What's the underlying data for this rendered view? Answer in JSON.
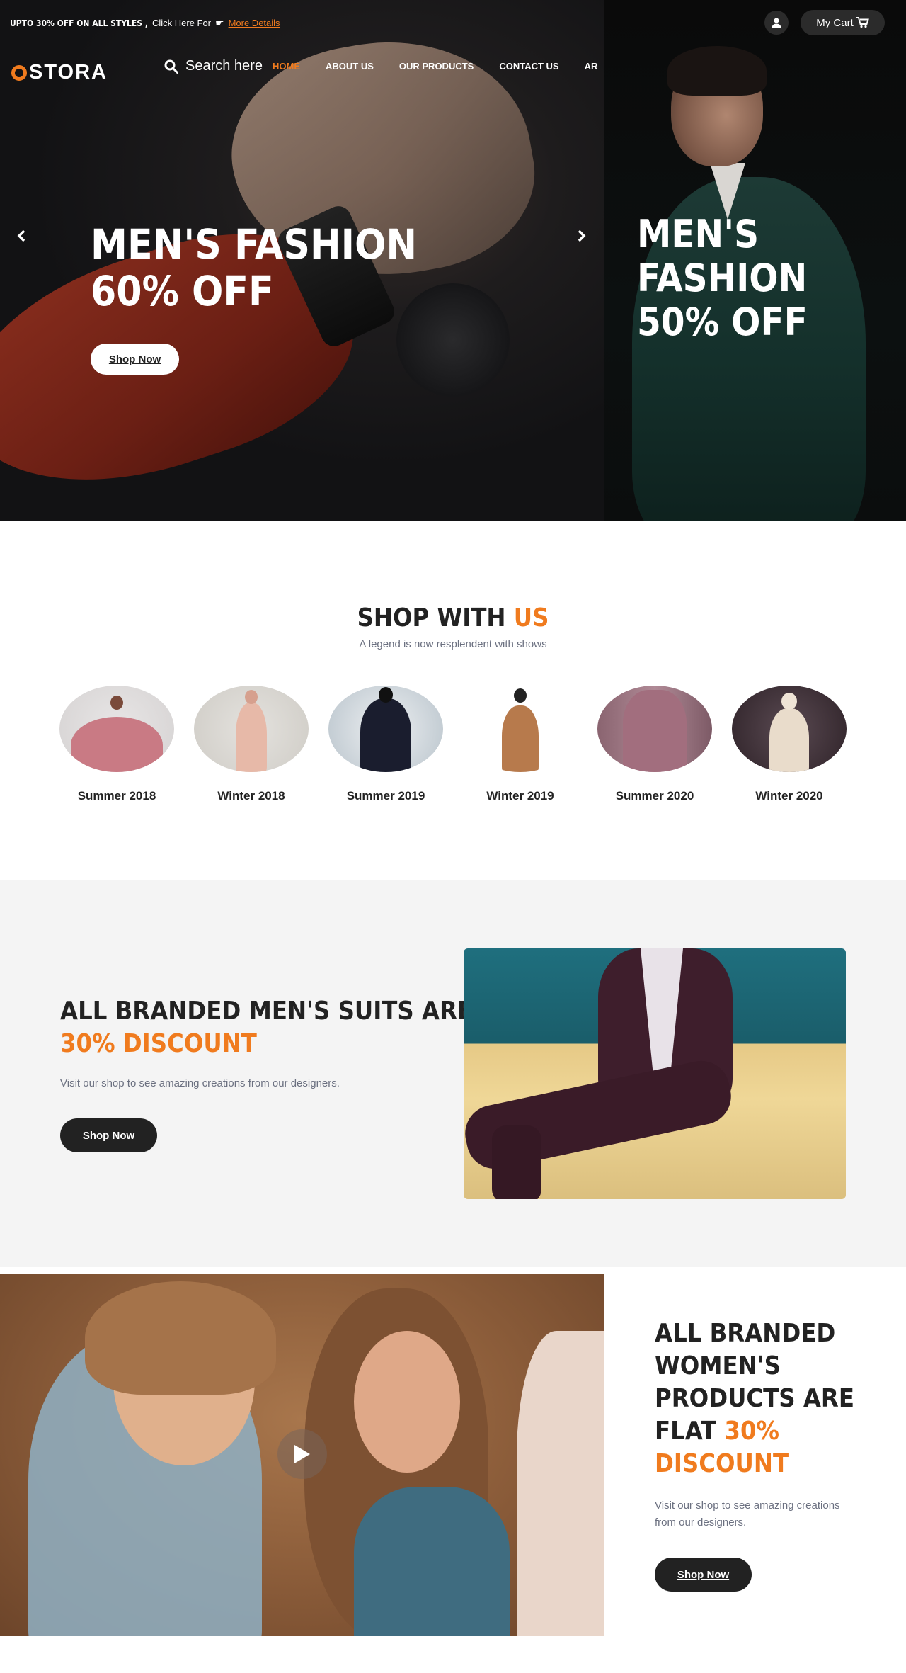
{
  "topbar": {
    "promo_main": "UPTO 30% OFF ON ALL STYLES ,",
    "promo_click": "Click Here For",
    "promo_more": "More Details",
    "cart_label": "My Cart"
  },
  "brand": {
    "logo_rest": "STORA"
  },
  "search": {
    "label": "Search here"
  },
  "nav": [
    "HOME",
    "ABOUT US",
    "OUR PRODUCTS",
    "CONTACT US",
    "AR"
  ],
  "hero": {
    "slide1": {
      "line1": "MEN'S FASHION",
      "line2": "60% OFF",
      "button": "Shop Now"
    },
    "slide2": {
      "line1": "MEN'S FASHION",
      "line2": "50% OFF"
    }
  },
  "shop": {
    "title_a": "SHOP WITH ",
    "title_b": "US",
    "subtitle": "A legend is now resplendent with shows",
    "collections": [
      "Summer 2018",
      "Winter 2018",
      "Summer 2019",
      "Winter 2019",
      "Summer 2020",
      "Winter 2020"
    ]
  },
  "suits": {
    "heading": "ALL BRANDED MEN'S SUITS ARE FLAT",
    "accent": "30% DISCOUNT",
    "text": "Visit our shop to see amazing creations from our designers.",
    "button": "Shop Now"
  },
  "women": {
    "heading": "ALL BRANDED WOMEN'S PRODUCTS ARE FLAT",
    "accent": "30% DISCOUNT",
    "text": "Visit our shop to see amazing creations from our designers.",
    "button": "Shop Now"
  },
  "colors": {
    "accent": "#f07b1e",
    "dark": "#222222",
    "muted": "#6b7080",
    "section_bg": "#f4f4f4"
  }
}
